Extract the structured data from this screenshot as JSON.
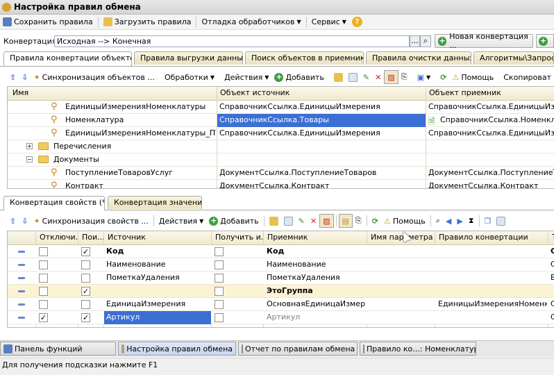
{
  "window": {
    "title": "Настройка правил обмена"
  },
  "toolbar": {
    "save": "Сохранить правила",
    "load": "Загрузить правила",
    "debug": "Отладка обработчиков",
    "service": "Сервис",
    "help": "?"
  },
  "conversion": {
    "label": "Конвертация:",
    "value": "Исходная --> Конечная",
    "browse": "...",
    "new_btn": "Новая конвертация ..."
  },
  "tabs": [
    "Правила конвертации объектов",
    "Правила выгрузки данных",
    "Поиск объектов в приемнике",
    "Правила очистки данных",
    "Алгоритмы\\Запросы"
  ],
  "upper_toolbar": {
    "sync": "Синхронизация объектов ...",
    "processing": "Обработки",
    "actions": "Действия",
    "add": "Добавить",
    "help": "Помощь",
    "copy": "Скопироват"
  },
  "upper_grid": {
    "headers": [
      "Имя",
      "Объект источник",
      "Объект приемник"
    ],
    "rows": [
      {
        "name": "ЕдиницыИзмеренияНоменклатуры",
        "src": "СправочникСсылка.ЕдиницыИзмерения",
        "dst": "СправочникСсылка.ЕдиницыИзмерения"
      },
      {
        "name": "Номенклатура",
        "src": "СправочникСсылка.Товары",
        "dst": "СправочникСсылка.Номенклатура"
      },
      {
        "name": "ЕдиницыИзмеренияНоменклатуры_ПТУ",
        "src": "СправочникСсылка.ЕдиницыИзмерения",
        "dst": "СправочникСсылка.ЕдиницыИзмерения"
      },
      {
        "name": "Перечисления",
        "src": "",
        "dst": ""
      },
      {
        "name": "Документы",
        "src": "",
        "dst": ""
      },
      {
        "name": "ПоступлениеТоваровУслуг",
        "src": "ДокументСсылка.ПоступлениеТоваров",
        "dst": "ДокументСсылка.ПоступлениеТовар"
      },
      {
        "name": "Контракт",
        "src": "ДокументСсылка.Контракт",
        "dst": "ДокументСсылка.Контракт"
      }
    ]
  },
  "lower_tabs": [
    "Конвертация свойств (*)",
    "Конвертация значений"
  ],
  "lower_toolbar": {
    "sync": "Синхронизация свойств ...",
    "actions": "Действия",
    "add": "Добавить",
    "help": "Помощь"
  },
  "lower_grid": {
    "headers": [
      "Отключи...",
      "Пои...",
      "Источник",
      "Получить и...",
      "Приемник",
      "Имя параметра",
      "Правило конвертации",
      "Т"
    ],
    "rows": [
      {
        "off": false,
        "search": true,
        "src": "Код",
        "get": false,
        "dst": "Код",
        "param": "",
        "rule": "",
        "t": "С"
      },
      {
        "off": false,
        "search": false,
        "src": "Наименование",
        "get": false,
        "dst": "Наименование",
        "param": "",
        "rule": "",
        "t": "С"
      },
      {
        "off": false,
        "search": false,
        "src": "ПометкаУдаления",
        "get": false,
        "dst": "ПометкаУдаления",
        "param": "",
        "rule": "",
        "t": "Б"
      },
      {
        "off": false,
        "search": true,
        "src": "",
        "get": false,
        "dst": "ЭтоГруппа",
        "param": "",
        "rule": "",
        "t": ""
      },
      {
        "off": false,
        "search": false,
        "src": "ЕдиницаИзмерения",
        "get": false,
        "dst": "ОсновнаяЕдиницаИзмер...",
        "param": "",
        "rule": "ЕдиницыИзмеренияНоменк...",
        "t": "С"
      },
      {
        "off": true,
        "search": true,
        "src": "Артикул",
        "get": false,
        "dst": "Артикул",
        "param": "",
        "rule": "",
        "t": "С"
      }
    ]
  },
  "taskbar": [
    "Панель функций",
    "Настройка правил обмена",
    "Отчет по правилам обмена ...",
    "Правило ко...: Номенклатура"
  ],
  "status": "Для получения подсказки нажмите F1"
}
